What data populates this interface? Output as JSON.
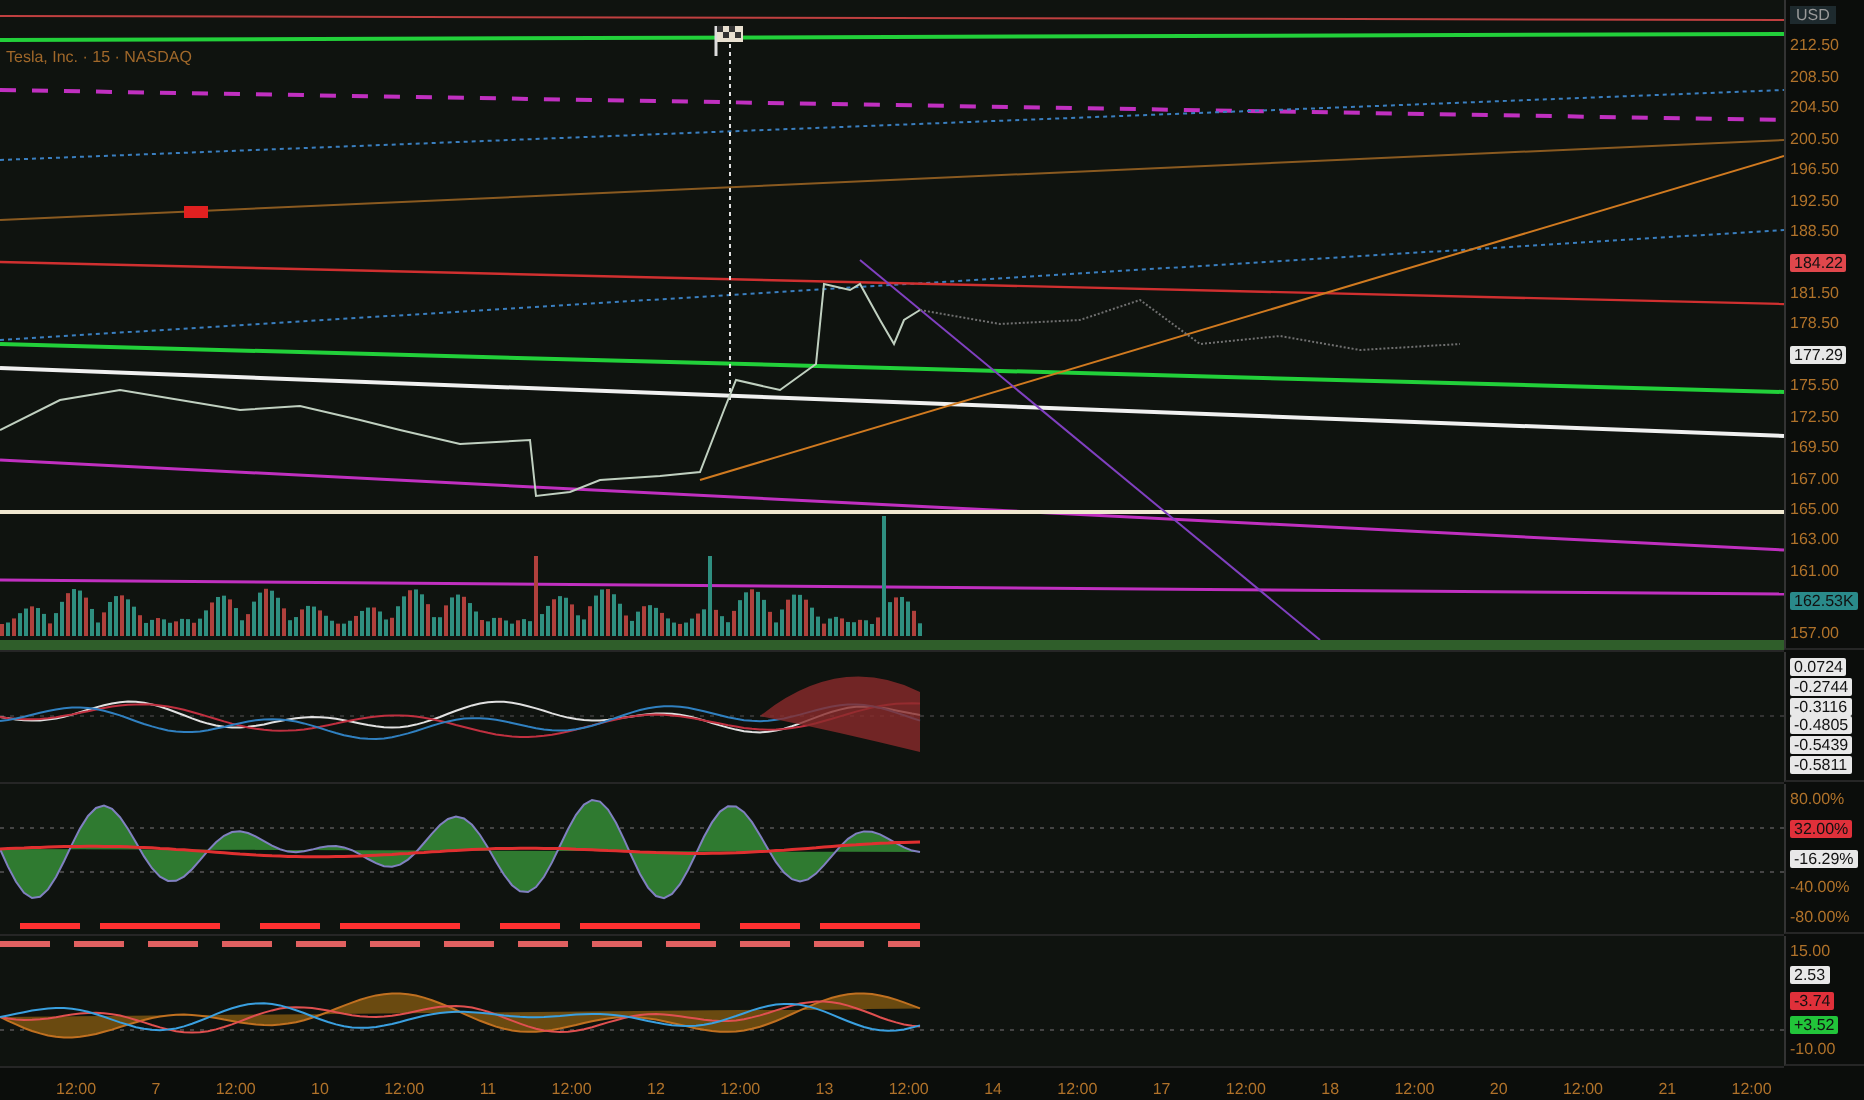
{
  "header": {
    "title": "Tesla, Inc. · 15 · NASDAQ",
    "currency": "USD"
  },
  "panes": [
    {
      "kind": "price",
      "axis": [
        {
          "kind": "tick",
          "text": "212.50"
        },
        {
          "kind": "tick",
          "text": "208.50"
        },
        {
          "kind": "tick",
          "text": "204.50"
        },
        {
          "kind": "tick",
          "text": "200.50"
        },
        {
          "kind": "tick",
          "text": "196.50"
        },
        {
          "kind": "tick",
          "text": "192.50"
        },
        {
          "kind": "tick",
          "text": "188.50"
        },
        {
          "kind": "badge",
          "text": "184.22",
          "color": "#e0474c"
        },
        {
          "kind": "tick",
          "text": "181.50"
        },
        {
          "kind": "tick",
          "text": "178.50"
        },
        {
          "kind": "badge",
          "text": "177.29",
          "color": "#e8e8e8"
        },
        {
          "kind": "tick",
          "text": "175.50"
        },
        {
          "kind": "tick",
          "text": "172.50"
        },
        {
          "kind": "tick",
          "text": "169.50"
        },
        {
          "kind": "tick",
          "text": "167.00"
        },
        {
          "kind": "tick",
          "text": "165.00"
        },
        {
          "kind": "tick",
          "text": "163.00"
        },
        {
          "kind": "tick",
          "text": "161.00"
        },
        {
          "kind": "badge",
          "text": "162.53K",
          "color": "#2a8a8a"
        },
        {
          "kind": "tick",
          "text": "157.00"
        }
      ]
    },
    {
      "kind": "macd",
      "axis": [
        {
          "kind": "badge",
          "text": "0.0724",
          "color": "#e8e8e8"
        },
        {
          "kind": "badge",
          "text": "-0.2744",
          "color": "#e8e8e8"
        },
        {
          "kind": "badge",
          "text": "-0.3116",
          "color": "#e8e8e8"
        },
        {
          "kind": "badge",
          "text": "-0.4805",
          "color": "#e8e8e8"
        },
        {
          "kind": "badge",
          "text": "-0.5439",
          "color": "#e8e8e8"
        },
        {
          "kind": "badge",
          "text": "-0.5811",
          "color": "#e8e8e8"
        }
      ]
    },
    {
      "kind": "rsi",
      "axis": [
        {
          "kind": "tick",
          "text": "80.00%"
        },
        {
          "kind": "badge",
          "text": "32.00%",
          "color": "#e0303a"
        },
        {
          "kind": "badge",
          "text": "-16.29%",
          "color": "#e8e8e8"
        },
        {
          "kind": "tick",
          "text": "-40.00%"
        },
        {
          "kind": "tick",
          "text": "-80.00%"
        }
      ]
    },
    {
      "kind": "adx",
      "axis": [
        {
          "kind": "tick",
          "text": "15.00"
        },
        {
          "kind": "badge",
          "text": "2.53",
          "color": "#e8e8e8"
        },
        {
          "kind": "badge",
          "text": "-3.74",
          "color": "#e0303a"
        },
        {
          "kind": "badge",
          "text": "+3.52",
          "color": "#22c43a"
        },
        {
          "kind": "tick",
          "text": "-10.00"
        }
      ]
    }
  ],
  "time_axis": [
    "12:00",
    "7",
    "12:00",
    "10",
    "12:00",
    "11",
    "12:00",
    "12",
    "12:00",
    "13",
    "12:00",
    "14",
    "12:00",
    "17",
    "12:00",
    "18",
    "12:00",
    "20",
    "12:00",
    "21",
    "12:00"
  ]
}
